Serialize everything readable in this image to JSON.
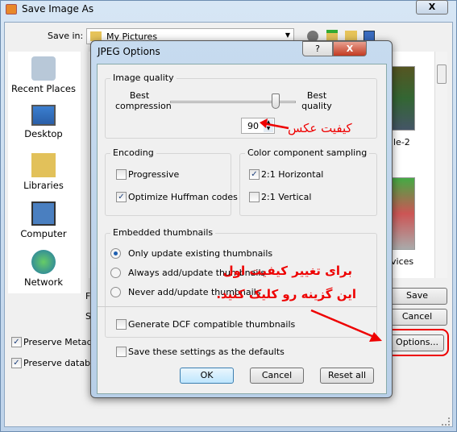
{
  "window": {
    "title": "Save Image As",
    "close": "X"
  },
  "save_in": {
    "label": "Save in:",
    "value": "My Pictures"
  },
  "places": [
    {
      "label": "Recent Places",
      "icon": "recent-places-icon"
    },
    {
      "label": "Desktop",
      "icon": "desktop-icon"
    },
    {
      "label": "Libraries",
      "icon": "libraries-icon"
    },
    {
      "label": "Computer",
      "icon": "computer-icon"
    },
    {
      "label": "Network",
      "icon": "network-icon"
    }
  ],
  "files": {
    "item1": "le-2",
    "item2": "vices"
  },
  "side_labels": {
    "f": "F",
    "s": "S"
  },
  "buttons": {
    "save": "Save",
    "cancel": "Cancel",
    "options": "Options..."
  },
  "checks": {
    "metadata": "Preserve Metadat",
    "database": "Preserve databas"
  },
  "jpeg": {
    "title": "JPEG Options",
    "help": "?",
    "close": "X",
    "quality": {
      "title": "Image quality",
      "left": "Best compression",
      "right": "Best quality",
      "value": "90",
      "level": 90
    },
    "encoding": {
      "title": "Encoding",
      "progressive": "Progressive",
      "huffman": "Optimize Huffman codes",
      "progressive_checked": false,
      "huffman_checked": true
    },
    "sampling": {
      "title": "Color component sampling",
      "horizontal": "2:1 Horizontal",
      "vertical": "2:1 Vertical",
      "horizontal_checked": true,
      "vertical_checked": false
    },
    "thumbs": {
      "title": "Embedded thumbnails",
      "only": "Only update existing thumbnails",
      "always": "Always add/update thumbnails",
      "never": "Never add/update thumbnails",
      "selected": "only",
      "dcf": "Generate DCF compatible thumbnails"
    },
    "defaults": "Save these settings as the defaults",
    "ok": "OK",
    "cancel": "Cancel",
    "reset": "Reset all"
  },
  "annotations": {
    "quality": "کیفیت عکس",
    "line1": "برای تغییر کیفیت اول",
    "line2": "این گزینه رو کلیک کنید.",
    "color": "#e00000"
  }
}
